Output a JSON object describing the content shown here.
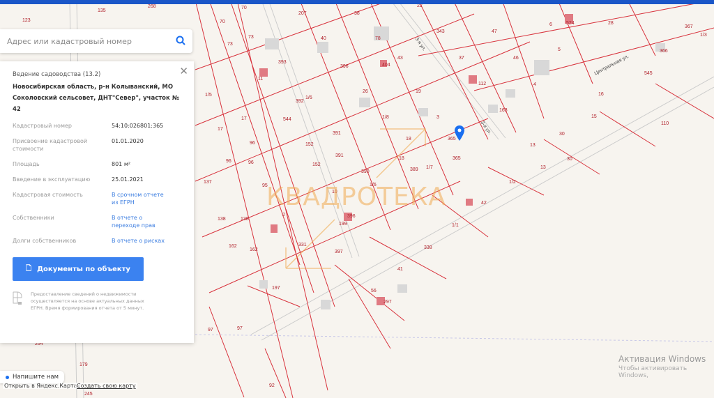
{
  "search": {
    "placeholder": "Адрес или кадастровый номер"
  },
  "panel": {
    "category": "Ведение садоводства (13.2)",
    "address": "Новосибирская область, р-н Колыванский, МО Соколовский сельсовет, ДНТ\"Север\", участок № 42",
    "rows": [
      {
        "k": "Кадастровый номер",
        "v": "54:10:026801:365"
      },
      {
        "k": "Присвоение кадастровой стоимости",
        "v": "01.01.2020"
      },
      {
        "k": "Площадь",
        "v": "801 м²"
      },
      {
        "k": "Введение в эксплуатацию",
        "v": "25.01.2021"
      },
      {
        "k": "Кадастровая стоимость",
        "v": "В срочном отчете из ЕГРН"
      },
      {
        "k": "Собственники",
        "v": "В отчете о переходе прав"
      },
      {
        "k": "Долги собственников",
        "v": "В отчете о рисках"
      }
    ],
    "button": "Документы по объекту",
    "note": "Предоставление сведений о недвижимости осуществляется на основе актуальных данных ЕГРН. Время формирования отчета от 5 минут."
  },
  "chat": "Напишите нам",
  "footer": {
    "open": "Открыть в Яндекс.Картах",
    "create": "Создать свою карту"
  },
  "watermark": "КВАДРОТЕКА",
  "activation": {
    "title": "Активация Windows",
    "sub": "Чтобы активировать Windows,"
  },
  "map": {
    "streets": [
      "Центральная ул.",
      "3-я ул.",
      "3-я ул."
    ],
    "labels": [
      "135",
      "268",
      "70",
      "207",
      "38",
      "22",
      "343",
      "47",
      "6",
      "524",
      "28",
      "367",
      "1/3",
      "123",
      "70",
      "73",
      "40",
      "78",
      "37",
      "5",
      "366",
      "73",
      "393",
      "396",
      "404",
      "43",
      "46",
      "11",
      "112",
      "4",
      "545",
      "1/5",
      "392",
      "1/6",
      "26",
      "19",
      "163",
      "16",
      "17",
      "17",
      "544",
      "391",
      "1/8",
      "3",
      "15",
      "110",
      "96",
      "96",
      "152",
      "391",
      "18",
      "365",
      "30",
      "13",
      "96",
      "152",
      "390",
      "18",
      "389",
      "1/7",
      "365",
      "13",
      "30",
      "137",
      "95",
      "10",
      "1/6",
      "1/2",
      "42",
      "138",
      "138",
      "2",
      "199",
      "396",
      "1/1",
      "162",
      "162",
      "331",
      "397",
      "338",
      "41",
      "197",
      "56",
      "297",
      "97",
      "97",
      "264",
      "179",
      "245",
      "92"
    ]
  }
}
